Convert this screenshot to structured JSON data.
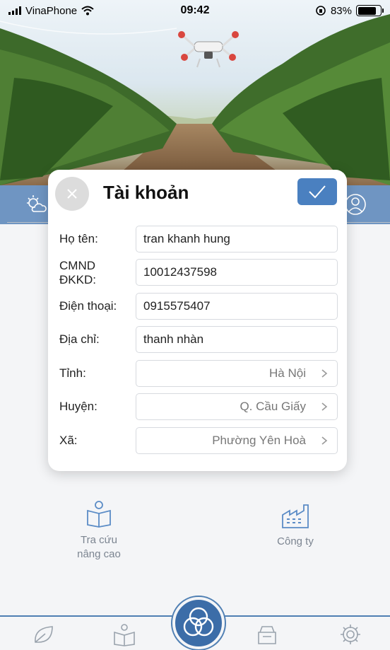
{
  "status_bar": {
    "carrier": "VinaPhone",
    "time": "09:42",
    "battery_text": "83%",
    "battery_level": 0.83
  },
  "modal": {
    "title": "Tài khoản",
    "fields": [
      {
        "label": "Họ tên:",
        "value": "tran khanh hung",
        "kind": "text"
      },
      {
        "label": "CMND\nĐKKD:",
        "value": "10012437598",
        "kind": "text"
      },
      {
        "label": "Điện thoại:",
        "value": "0915575407",
        "kind": "text"
      },
      {
        "label": "Địa chỉ:",
        "value": "thanh nhàn",
        "kind": "text"
      },
      {
        "label": "Tỉnh:",
        "value": "Hà Nội",
        "kind": "select"
      },
      {
        "label": "Huyện:",
        "value": "Q. Cầu Giấy",
        "kind": "select"
      },
      {
        "label": "Xã:",
        "value": "Phường Yên Hoà",
        "kind": "select"
      }
    ]
  },
  "tiles": {
    "advanced_search": "Tra cứu\nnâng cao",
    "company": "Công ty"
  },
  "icons": {
    "close": "close-icon",
    "confirm": "checkmark-icon",
    "weather": "weather-icon",
    "profile": "profile-icon",
    "book": "book-reader-icon",
    "factory": "factory-icon",
    "leaf": "leaf-icon",
    "archive": "archive-box-icon",
    "settings": "gear-icon",
    "center": "logo-icon"
  },
  "colors": {
    "accent": "#4a80c0",
    "nav_strip": "#6f95c2",
    "tile_text": "#7c8591"
  }
}
